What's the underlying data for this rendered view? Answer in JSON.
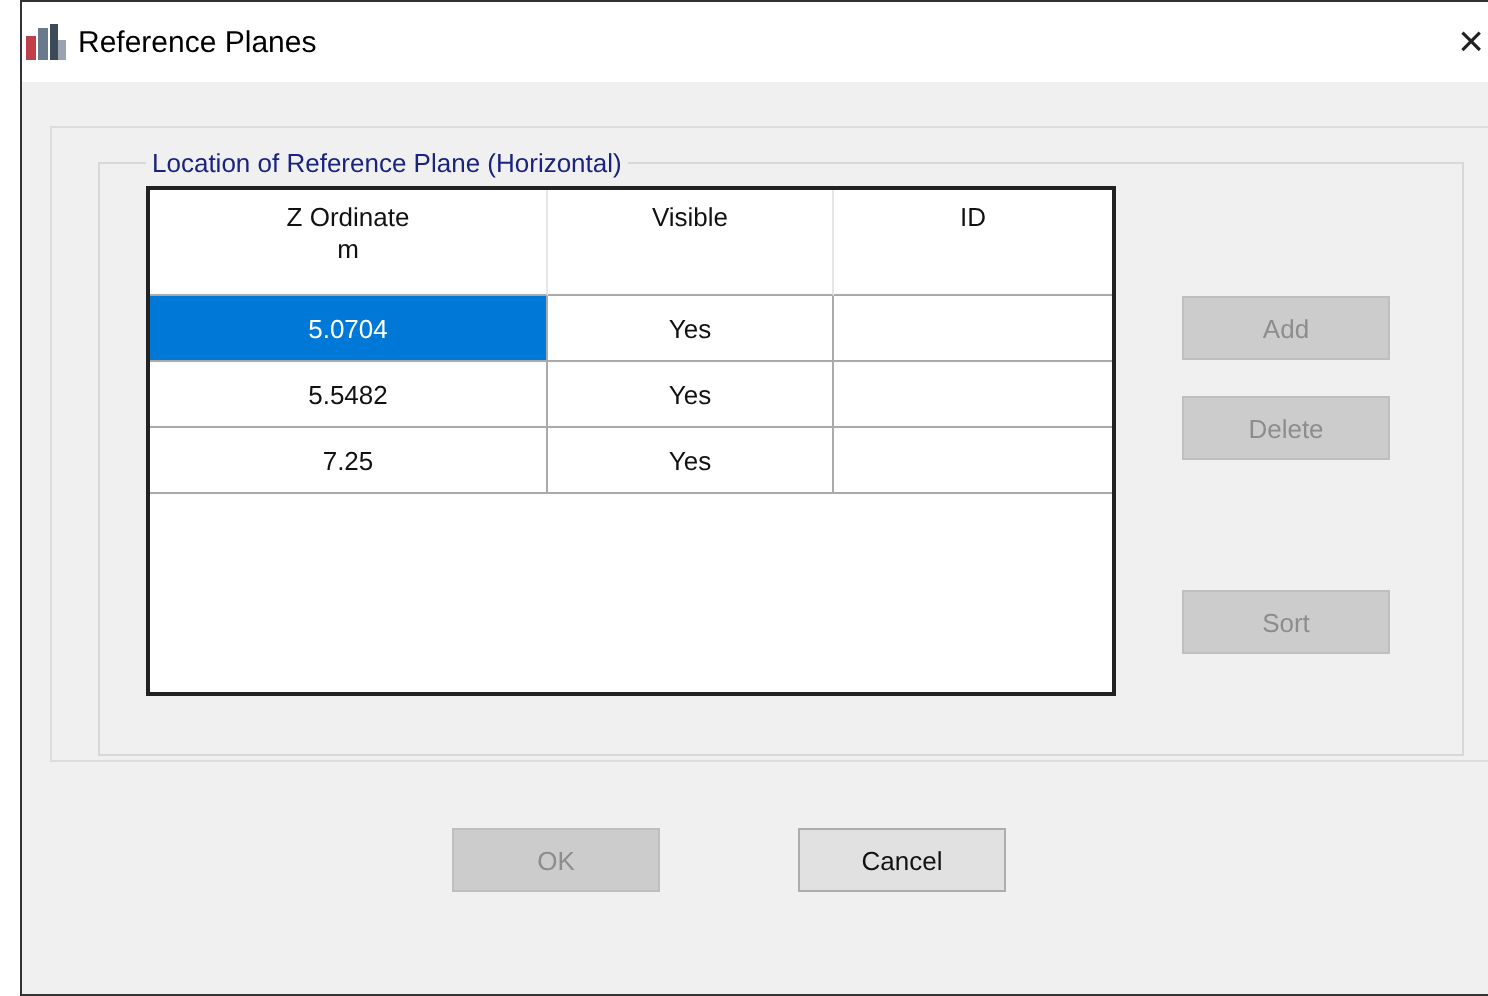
{
  "window": {
    "title": "Reference Planes",
    "close": "×"
  },
  "group": {
    "title": "Location of Reference Plane  (Horizontal)"
  },
  "table": {
    "columns": [
      {
        "label": "Z Ordinate",
        "unit": "m"
      },
      {
        "label": "Visible"
      },
      {
        "label": "ID"
      }
    ],
    "rows": [
      {
        "cells": [
          "5.0704",
          "Yes",
          ""
        ],
        "selected": true
      },
      {
        "cells": [
          "5.5482",
          "Yes",
          ""
        ],
        "selected": false
      },
      {
        "cells": [
          "7.25",
          "Yes",
          ""
        ],
        "selected": false
      }
    ]
  },
  "side_buttons": [
    {
      "label": "Add",
      "disabled": true,
      "kind": "top"
    },
    {
      "label": "Delete",
      "disabled": true,
      "kind": "top"
    },
    {
      "label": "Sort",
      "disabled": true,
      "kind": "bottom"
    }
  ],
  "buttons": [
    {
      "label": "OK",
      "disabled": true
    },
    {
      "label": "Cancel",
      "disabled": false
    }
  ]
}
